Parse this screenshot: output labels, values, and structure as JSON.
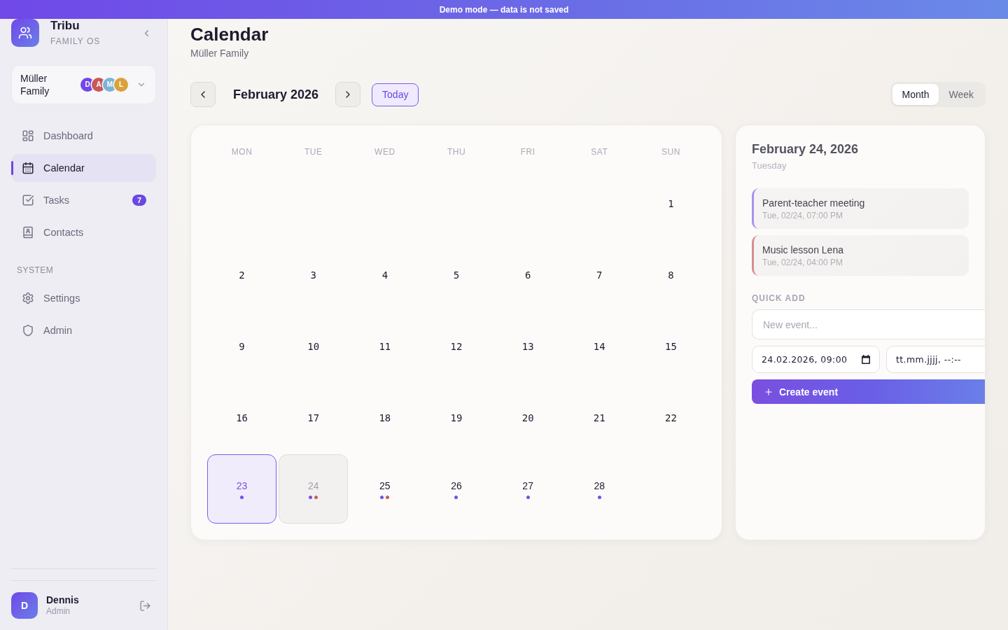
{
  "banner": {
    "text": "Demo mode — data is not saved"
  },
  "sidebar": {
    "brand": {
      "name": "Tribu",
      "tagline": "FAMILY OS"
    },
    "family": {
      "name": "Müller Family",
      "members": [
        {
          "initial": "D",
          "color": "#7048e8"
        },
        {
          "initial": "A",
          "color": "#c95858"
        },
        {
          "initial": "M",
          "color": "#7ab3d6"
        },
        {
          "initial": "L",
          "color": "#d9a23a"
        }
      ]
    },
    "sections": [
      {
        "items": [
          {
            "label": "Dashboard",
            "selected": false
          },
          {
            "label": "Calendar",
            "selected": true
          },
          {
            "label": "Tasks",
            "selected": false,
            "badge": "7"
          },
          {
            "label": "Contacts",
            "selected": false
          }
        ]
      },
      {
        "title": "SYSTEM",
        "items": [
          {
            "label": "Settings",
            "selected": false
          },
          {
            "label": "Admin",
            "selected": false
          }
        ]
      }
    ],
    "user": {
      "initial": "D",
      "name": "Dennis",
      "role": "Admin"
    }
  },
  "header": {
    "title": "Calendar",
    "subtitle": "Müller Family"
  },
  "toolbar": {
    "month": "February 2026",
    "today_button": "Today",
    "views": [
      {
        "label": "Month",
        "selected": true
      },
      {
        "label": "Week",
        "selected": false
      }
    ]
  },
  "calendar": {
    "weekdays": [
      "MON",
      "TUE",
      "WED",
      "THU",
      "FRI",
      "SAT",
      "SUN"
    ],
    "weeks": [
      {
        "days": [
          {
            "day": "1",
            "today": false,
            "selected": false
          }
        ]
      },
      {
        "days": [
          {
            "day": "2",
            "today": false,
            "selected": false
          },
          {
            "day": "3",
            "today": false,
            "selected": false
          },
          {
            "day": "4",
            "today": false,
            "selected": false
          },
          {
            "day": "5",
            "today": false,
            "selected": false
          },
          {
            "day": "6",
            "today": false,
            "selected": false
          },
          {
            "day": "7",
            "today": false,
            "selected": false
          },
          {
            "day": "8",
            "today": false,
            "selected": false
          }
        ]
      },
      {
        "days": [
          {
            "day": "9",
            "today": false,
            "selected": false
          },
          {
            "day": "10",
            "today": false,
            "selected": false
          },
          {
            "day": "11",
            "today": false,
            "selected": false
          },
          {
            "day": "12",
            "today": false,
            "selected": false
          },
          {
            "day": "13",
            "today": false,
            "selected": false
          },
          {
            "day": "14",
            "today": false,
            "selected": false
          },
          {
            "day": "15",
            "today": false,
            "selected": false
          }
        ]
      },
      {
        "days": [
          {
            "day": "16",
            "today": false,
            "selected": false
          },
          {
            "day": "17",
            "today": false,
            "selected": false
          },
          {
            "day": "18",
            "today": false,
            "selected": false
          },
          {
            "day": "19",
            "today": false,
            "selected": false
          },
          {
            "day": "20",
            "today": false,
            "selected": false
          },
          {
            "day": "21",
            "today": false,
            "selected": false
          },
          {
            "day": "22",
            "today": false,
            "selected": false
          }
        ]
      },
      {
        "days": [
          {
            "day": "23",
            "today": true,
            "selected": false,
            "events": [
              {
                "color": "#7b4fe2"
              }
            ]
          },
          {
            "day": "24",
            "today": false,
            "selected": true,
            "events": [
              {
                "color": "#7b4fe2"
              },
              {
                "color": "#cc5e5e"
              }
            ]
          },
          {
            "day": "25",
            "today": false,
            "selected": false,
            "events": [
              {
                "color": "#7b4fe2"
              },
              {
                "color": "#cc5e5e"
              }
            ]
          },
          {
            "day": "26",
            "today": false,
            "selected": false,
            "events": [
              {
                "color": "#7b4fe2"
              }
            ]
          },
          {
            "day": "27",
            "today": false,
            "selected": false,
            "events": [
              {
                "color": "#7b4fe2"
              }
            ]
          },
          {
            "day": "28",
            "today": false,
            "selected": false,
            "events": [
              {
                "color": "#7b4fe2"
              }
            ]
          }
        ]
      }
    ]
  },
  "day_panel": {
    "date": "February 24, 2026",
    "weekday": "Tuesday",
    "events": [
      {
        "title": "Parent-teacher meeting",
        "time": "Tue, 02/24, 07:00 PM",
        "color": "#a98ff0"
      },
      {
        "title": "Music lesson Lena",
        "time": "Tue, 02/24, 04:00 PM",
        "color": "#d98c8c"
      }
    ],
    "quick_add": {
      "label": "QUICK ADD",
      "title_field": {
        "placeholder": "New event..."
      },
      "start_field": {
        "value": "24.02.2026, 09:00"
      },
      "end_field": {
        "placeholder": "tt.mm.jjjj, --:--"
      },
      "create_button": "Create event"
    }
  }
}
